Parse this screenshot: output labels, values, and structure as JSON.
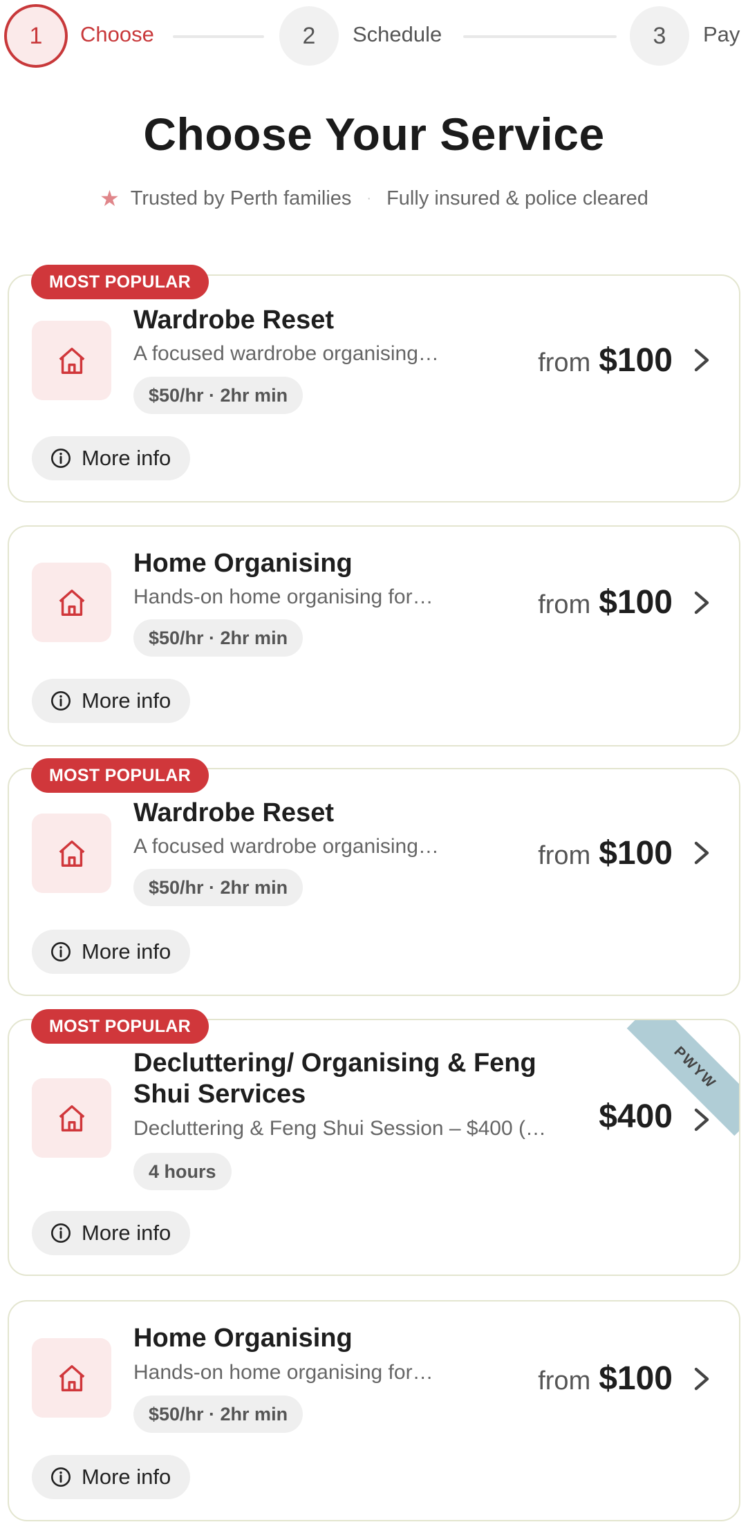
{
  "stepper": {
    "steps": [
      {
        "number": "1",
        "label": "Choose"
      },
      {
        "number": "2",
        "label": "Schedule"
      },
      {
        "number": "3",
        "label": "Pay"
      }
    ],
    "active_index": 0,
    "accent_color": "#c8383a"
  },
  "header": {
    "title": "Choose Your Service",
    "trust_1": "Trusted by Perth families",
    "trust_2": "Fully insured & police cleared",
    "star_icon": "star-icon"
  },
  "services": [
    {
      "badge": "MOST POPULAR",
      "title": "Wardrobe Reset",
      "desc": "A focused wardrobe organising…",
      "chip": "$50/hr · 2hr min",
      "price_prefix": "from",
      "price": "$100",
      "more": "More info",
      "icon": "home-icon"
    },
    {
      "badge": "",
      "title": "Home Organising",
      "desc": "Hands-on home organising for…",
      "chip": "$50/hr · 2hr min",
      "price_prefix": "from",
      "price": "$100",
      "more": "More info",
      "icon": "home-icon"
    },
    {
      "badge": "MOST POPULAR",
      "title": "Wardrobe Reset",
      "desc": "A focused wardrobe organising…",
      "chip": "$50/hr · 2hr min",
      "price_prefix": "from",
      "price": "$100",
      "more": "More info",
      "icon": "home-icon"
    },
    {
      "badge": "MOST POPULAR",
      "title": "Decluttering/ Organising & Feng Shui Services",
      "desc": "Decluttering & Feng Shui Session – $400 (…",
      "chip": "4 hours",
      "price_prefix": "",
      "price": "$400",
      "more": "More info",
      "icon": "home-icon",
      "ribbon": "PWYW"
    },
    {
      "badge": "",
      "title": "Home Organising",
      "desc": "Hands-on home organising for…",
      "chip": "$50/hr · 2hr min",
      "price_prefix": "from",
      "price": "$100",
      "more": "More info",
      "icon": "home-icon"
    }
  ],
  "colors": {
    "badge": "#d0373b",
    "ribbon": "#b0cdd6",
    "card_border": "#e3e5cf",
    "icon_bg": "#fbeaea"
  }
}
